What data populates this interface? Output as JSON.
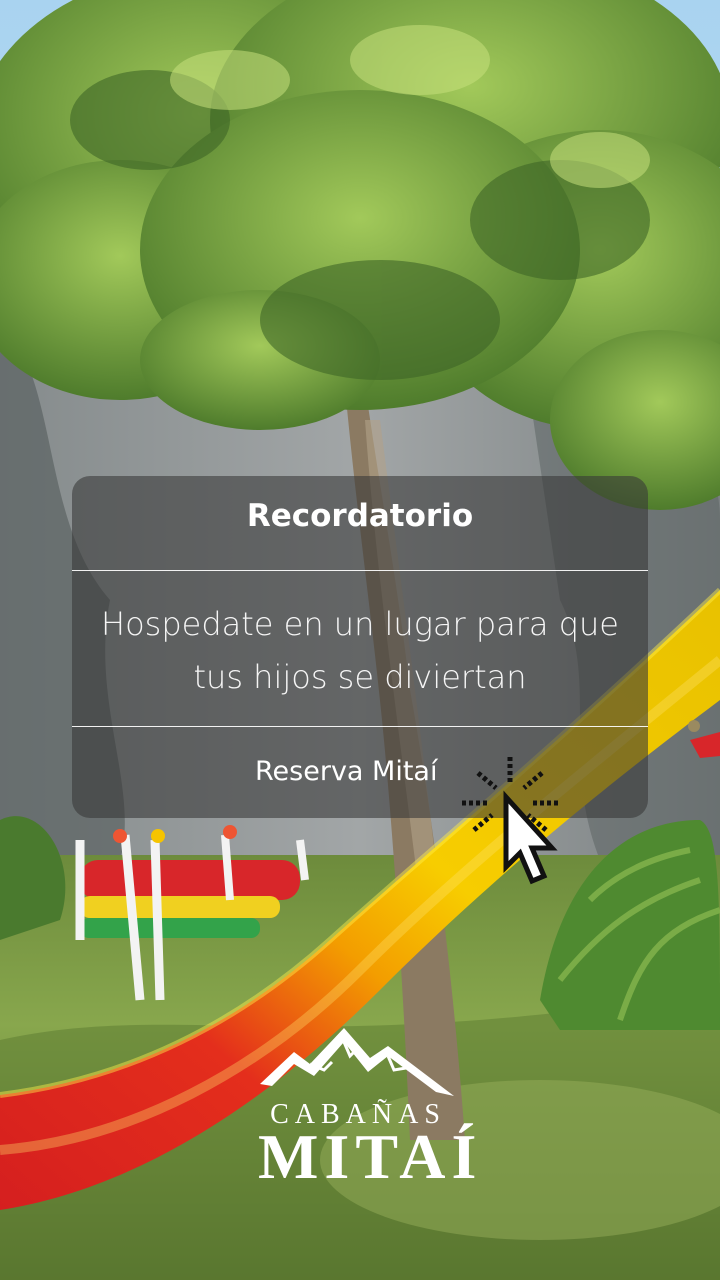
{
  "reminder": {
    "title": "Recordatorio",
    "message_lines": [
      "Hospedate en un lugar para que",
      "tus hijos se diviertan"
    ],
    "cta_label": "Reserva Mitaí"
  },
  "cursor": {
    "icon": "pointer-click-icon"
  },
  "brand": {
    "logo_icon": "mountains-icon",
    "line1": "CABAÑAS",
    "line2": "MITAÍ"
  },
  "colors": {
    "card": "rgba(55,55,55,0.58)",
    "slide_yellow": "#f5c800",
    "slide_red": "#dc1f20",
    "grass": "#7c9f43"
  }
}
